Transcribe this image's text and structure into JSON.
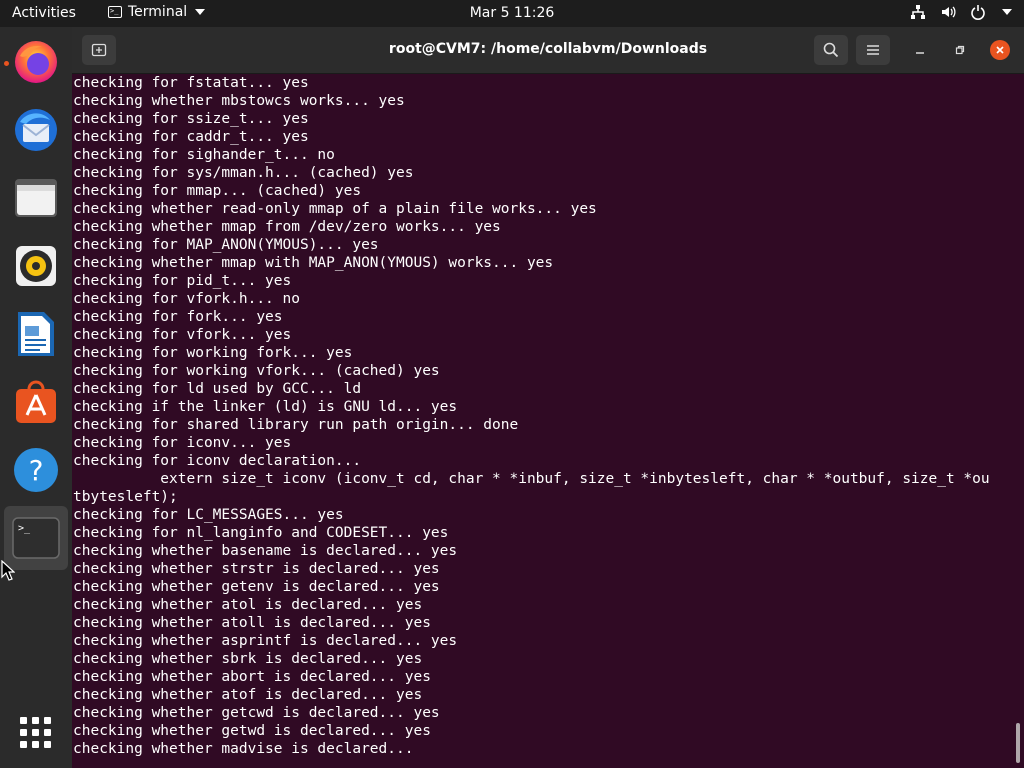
{
  "topbar": {
    "activities": "Activities",
    "app_name": "Terminal",
    "clock": "Mar 5  11:26"
  },
  "dock": {
    "items": [
      "firefox",
      "thunderbird",
      "files",
      "rhythmbox",
      "libreoffice-writer",
      "ubuntu-software",
      "help",
      "terminal"
    ]
  },
  "window": {
    "title": "root@CVM7: /home/collabvm/Downloads"
  },
  "terminal": {
    "lines": [
      "checking for fstatat... yes",
      "checking whether mbstowcs works... yes",
      "checking for ssize_t... yes",
      "checking for caddr_t... yes",
      "checking for sighander_t... no",
      "checking for sys/mman.h... (cached) yes",
      "checking for mmap... (cached) yes",
      "checking whether read-only mmap of a plain file works... yes",
      "checking whether mmap from /dev/zero works... yes",
      "checking for MAP_ANON(YMOUS)... yes",
      "checking whether mmap with MAP_ANON(YMOUS) works... yes",
      "checking for pid_t... yes",
      "checking for vfork.h... no",
      "checking for fork... yes",
      "checking for vfork... yes",
      "checking for working fork... yes",
      "checking for working vfork... (cached) yes",
      "checking for ld used by GCC... ld",
      "checking if the linker (ld) is GNU ld... yes",
      "checking for shared library run path origin... done",
      "checking for iconv... yes",
      "checking for iconv declaration...",
      "          extern size_t iconv (iconv_t cd, char * *inbuf, size_t *inbytesleft, char * *outbuf, size_t *ou",
      "tbytesleft);",
      "checking for LC_MESSAGES... yes",
      "checking for nl_langinfo and CODESET... yes",
      "checking whether basename is declared... yes",
      "checking whether strstr is declared... yes",
      "checking whether getenv is declared... yes",
      "checking whether atol is declared... yes",
      "checking whether atoll is declared... yes",
      "checking whether asprintf is declared... yes",
      "checking whether sbrk is declared... yes",
      "checking whether abort is declared... yes",
      "checking whether atof is declared... yes",
      "checking whether getcwd is declared... yes",
      "checking whether getwd is declared... yes",
      "checking whether madvise is declared..."
    ]
  }
}
